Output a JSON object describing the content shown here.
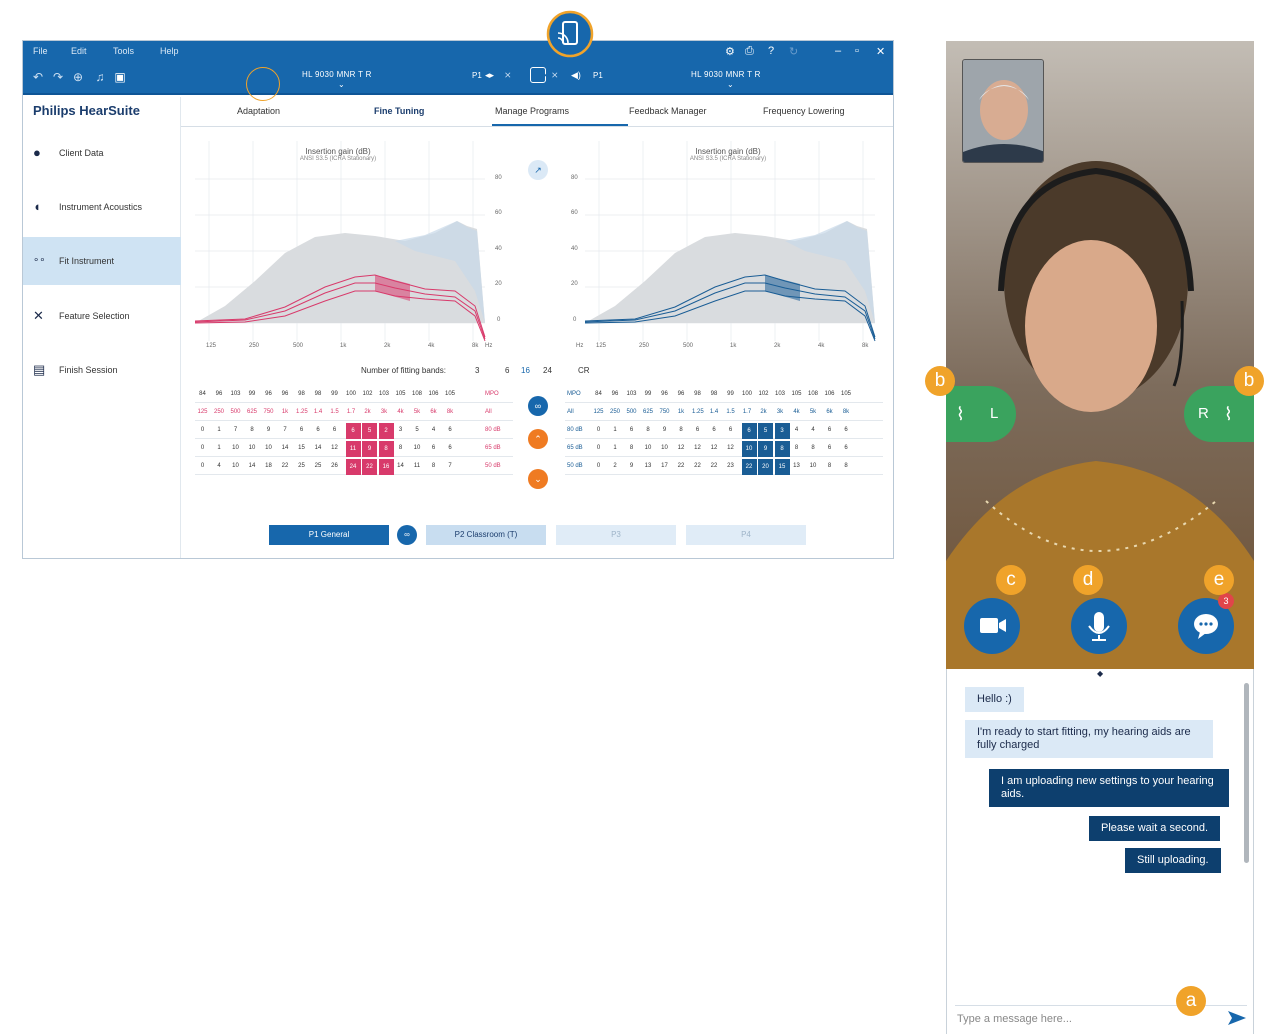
{
  "app": {
    "menu": [
      "File",
      "Edit",
      "Tools",
      "Help"
    ],
    "title_right": "HL 9030 MNR T R",
    "title_left": "HL 9030 MNR T R",
    "center_left_label": "P1",
    "center_right_label": "P1",
    "brand": "Philips HearSuite",
    "sidebar": [
      {
        "label": "Client Data",
        "icon": "person-icon"
      },
      {
        "label": "Instrument Acoustics",
        "icon": "hearing-aid-icon"
      },
      {
        "label": "Fit Instrument",
        "icon": "fit-icon"
      },
      {
        "label": "Feature Selection",
        "icon": "tools-icon"
      },
      {
        "label": "Finish Session",
        "icon": "monitor-icon"
      }
    ],
    "tabs": [
      "Adaptation",
      "Fine Tuning",
      "Manage Programs",
      "Feedback Manager",
      "Frequency Lowering"
    ],
    "active_tab": "Fine Tuning",
    "chart_left": {
      "title": "Insertion gain (dB)",
      "subtitle": "ANSI S3.5 (ICRA Stationary)"
    },
    "chart_right": {
      "title": "Insertion gain (dB)",
      "subtitle": "ANSI S3.5 (ICRA Stationary)"
    },
    "y_ticks": [
      "80",
      "60",
      "40",
      "20",
      "0"
    ],
    "x_ticks": [
      "125",
      "250",
      "500",
      "1k",
      "2k",
      "4k",
      "8k"
    ],
    "x_unit": "Hz",
    "fitting_bands_label": "Number of fitting bands:",
    "fitting_bands": [
      "3",
      "6",
      "16",
      "24"
    ],
    "active_band": "16",
    "cr_label": "CR",
    "left_table": {
      "mpo": [
        "84",
        "96",
        "103",
        "99",
        "96",
        "96",
        "98",
        "98",
        "99",
        "100",
        "102",
        "103",
        "105",
        "108",
        "106",
        "105"
      ],
      "mpo_label": "MPO",
      "freqs": [
        "125",
        "250",
        "500",
        "625",
        "750",
        "1k",
        "1.25",
        "1.4",
        "1.5",
        "1.7",
        "2k",
        "3k",
        "4k",
        "5k",
        "6k",
        "8k"
      ],
      "freq_label": "All",
      "rows": [
        {
          "label": "80 dB",
          "values": [
            "0",
            "1",
            "7",
            "8",
            "9",
            "7",
            "6",
            "6",
            "6",
            "6",
            "5",
            "2",
            "3",
            "5",
            "4",
            "6"
          ]
        },
        {
          "label": "65 dB",
          "values": [
            "0",
            "1",
            "10",
            "10",
            "10",
            "14",
            "15",
            "14",
            "12",
            "11",
            "9",
            "8",
            "8",
            "10",
            "6",
            "6"
          ]
        },
        {
          "label": "50 dB",
          "values": [
            "0",
            "4",
            "10",
            "14",
            "18",
            "22",
            "25",
            "25",
            "26",
            "24",
            "22",
            "16",
            "14",
            "11",
            "8",
            "7"
          ]
        }
      ]
    },
    "right_table": {
      "mpo": [
        "84",
        "96",
        "103",
        "99",
        "96",
        "96",
        "98",
        "98",
        "99",
        "100",
        "102",
        "103",
        "105",
        "108",
        "106",
        "105"
      ],
      "mpo_label": "MPO",
      "freqs": [
        "125",
        "250",
        "500",
        "625",
        "750",
        "1k",
        "1.25",
        "1.4",
        "1.5",
        "1.7",
        "2k",
        "3k",
        "4k",
        "5k",
        "6k",
        "8k"
      ],
      "freq_label": "All",
      "rows": [
        {
          "label": "80 dB",
          "values": [
            "0",
            "1",
            "6",
            "8",
            "9",
            "8",
            "6",
            "6",
            "6",
            "6",
            "5",
            "3",
            "4",
            "4",
            "6",
            "6"
          ]
        },
        {
          "label": "65 dB",
          "values": [
            "0",
            "1",
            "8",
            "10",
            "10",
            "12",
            "12",
            "12",
            "12",
            "10",
            "9",
            "8",
            "8",
            "8",
            "6",
            "6"
          ]
        },
        {
          "label": "50 dB",
          "values": [
            "0",
            "2",
            "9",
            "13",
            "17",
            "22",
            "22",
            "22",
            "23",
            "22",
            "20",
            "15",
            "13",
            "10",
            "8",
            "8"
          ]
        }
      ]
    },
    "programs": [
      "P1 General",
      "P2 Classroom (T)",
      "P3",
      "P4"
    ],
    "colors": {
      "header": "#1767ac",
      "left_ear": "#d83a6b",
      "right_ear": "#1a5d95",
      "accent": "#f0a32a",
      "ear_button": "#3aa35e"
    }
  },
  "video": {
    "left_ear_label": "L",
    "right_ear_label": "R",
    "chat_badge": "3"
  },
  "chat": {
    "messages": [
      {
        "from": "client",
        "text": "Hello :)"
      },
      {
        "from": "client",
        "text": "I'm ready to start fitting, my hearing aids are fully charged"
      },
      {
        "from": "professional",
        "text": "I am uploading new settings to your hearing aids."
      },
      {
        "from": "professional",
        "text": "Please wait a second."
      },
      {
        "from": "professional",
        "text": "Still uploading."
      }
    ],
    "input_placeholder": "Type a message here..."
  },
  "callouts": {
    "a": "a",
    "b": "b",
    "c": "c",
    "d": "d",
    "e": "e"
  }
}
